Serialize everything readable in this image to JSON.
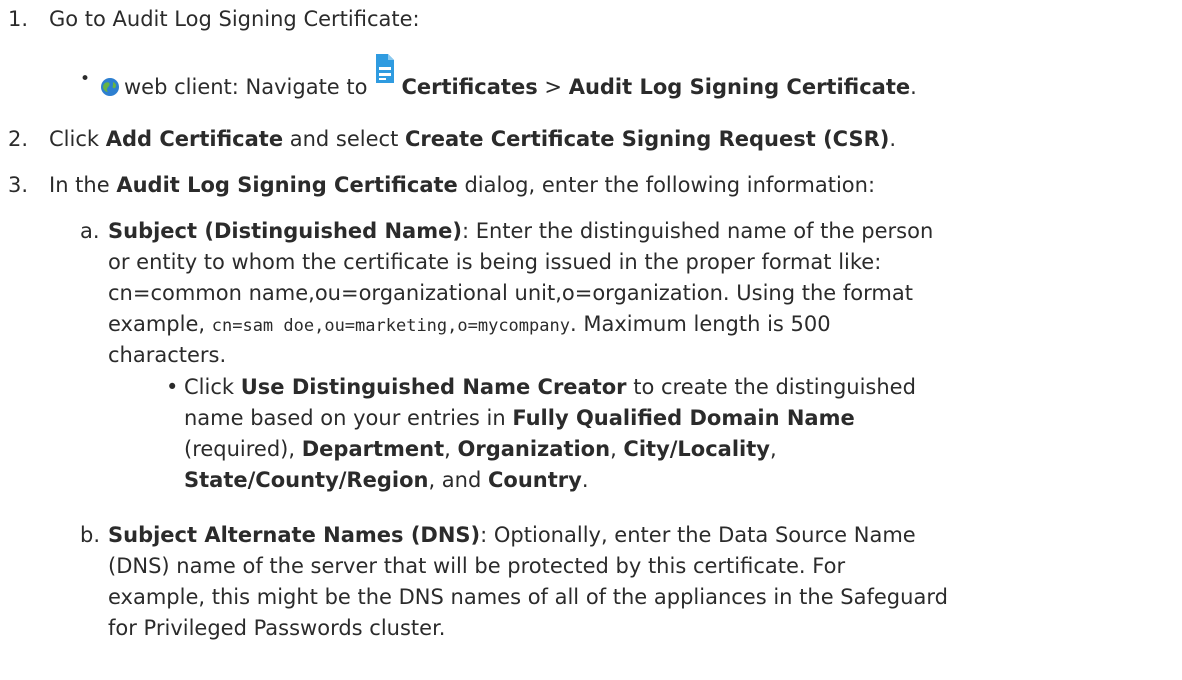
{
  "steps": {
    "s1": {
      "num": "1.",
      "text": "Go to Audit Log Signing Certificate:",
      "bullet": {
        "client": "web client: Navigate to",
        "cert": "Certificates",
        "sep": ">",
        "target": "Audit Log Signing Certificate",
        "end": "."
      }
    },
    "s2": {
      "num": "2.",
      "p1": "Click ",
      "b1": "Add Certificate",
      "p2": " and select ",
      "b2": "Create Certificate Signing Request (CSR)",
      "p3": "."
    },
    "s3": {
      "num": "3.",
      "p1": "In the ",
      "b1": "Audit Log Signing Certificate",
      "p2": " dialog, enter the following information:",
      "a": {
        "letter": "a.",
        "label": "Subject (Distinguished Name)",
        "line1": ": Enter the distinguished name of the person",
        "line2": "or entity to whom the certificate is being issued in the proper format like:",
        "line3": "cn=common name,ou=organizational unit,o=organization. Using the format",
        "line4_pre": "example, ",
        "line4_code": "cn=sam doe,ou=marketing,o=mycompany",
        "line4_post": ". Maximum length is 500",
        "line5": "characters.",
        "sub": {
          "p1": "Click ",
          "b1": "Use Distinguished Name Creator",
          "p2": " to create the distinguished",
          "p3": "name based on your entries in ",
          "b2": "Fully Qualified Domain Name",
          "p4": "(required), ",
          "b3": "Department",
          "c1": ", ",
          "b4": "Organization",
          "c2": ", ",
          "b5": "City/Locality",
          "c3": ",",
          "b6": "State/County/Region",
          "p5": ", and ",
          "b7": "Country",
          "p6": "."
        }
      },
      "b": {
        "letter": "b.",
        "label": "Subject Alternate Names (DNS)",
        "line1": ": Optionally, enter the Data Source Name",
        "line2": "(DNS) name of the server that will be protected by this certificate. For",
        "line3": "example, this might be the DNS names of all of the appliances in the Safeguard",
        "line4": "for Privileged Passwords cluster."
      }
    }
  },
  "icons": {
    "globe": "globe-icon",
    "document": "document-icon",
    "accent": "#2f9be0",
    "globe_blue": "#2d7fd0",
    "globe_green": "#67b345"
  }
}
